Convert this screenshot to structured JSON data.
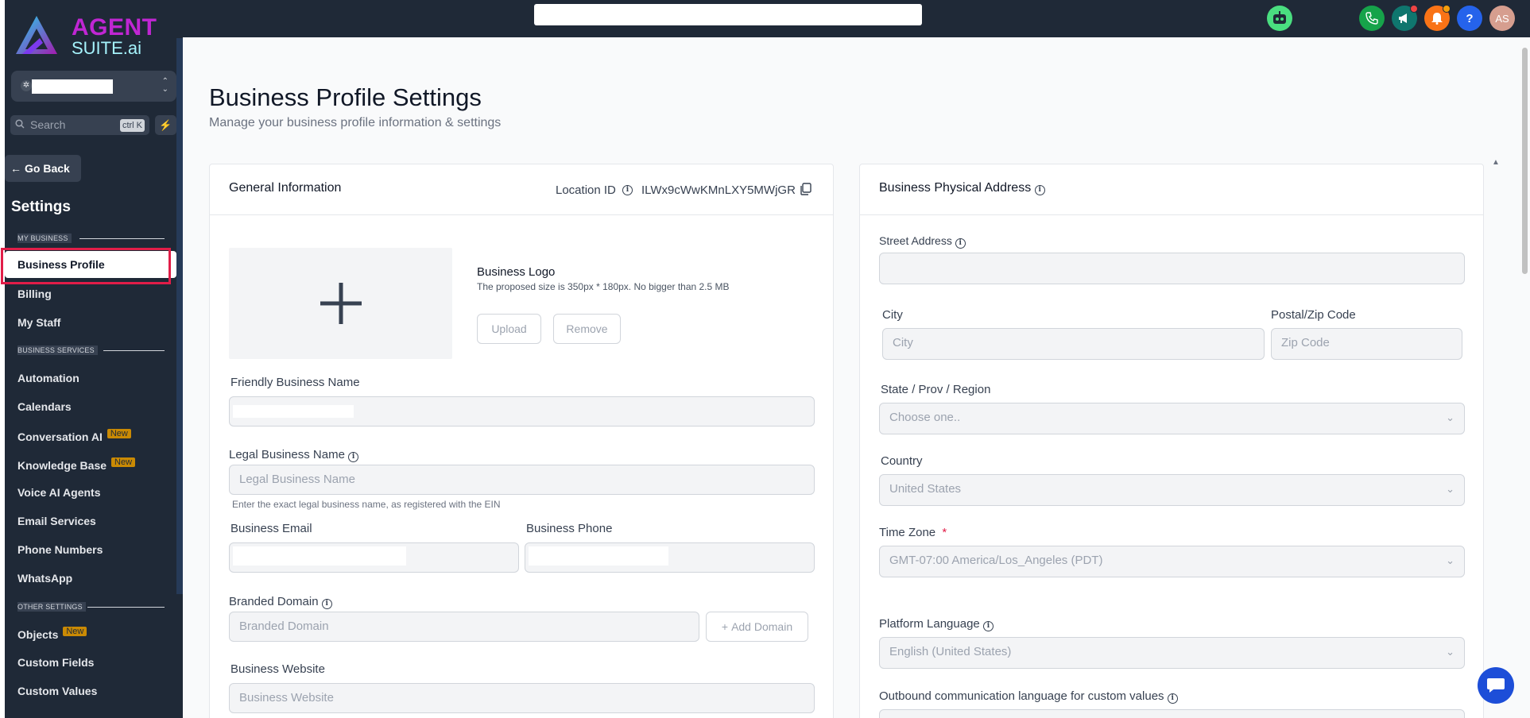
{
  "app": {
    "logo_line1": "AGENT",
    "logo_line2": "SUITE.ai"
  },
  "topbar": {
    "avatar_initials": "AS",
    "help_label": "?",
    "icons": [
      "robot-icon",
      "phone-icon",
      "megaphone-icon",
      "bell-icon",
      "help-icon"
    ],
    "colors": {
      "phone": "#16a34a",
      "megaphone": "#0f766e",
      "bell": "#f97316",
      "help": "#2563eb",
      "avatar": "#d69e8f",
      "robot": "#4ade80"
    }
  },
  "sidebar": {
    "search_placeholder": "Search",
    "search_shortcut": "ctrl K",
    "go_back": "Go Back",
    "title": "Settings",
    "sections": {
      "my_business": "MY BUSINESS",
      "business_services": "BUSINESS SERVICES",
      "other_settings": "OTHER SETTINGS"
    },
    "items": [
      {
        "label": "Business Profile",
        "active": true
      },
      {
        "label": "Billing"
      },
      {
        "label": "My Staff"
      },
      {
        "label": "Automation"
      },
      {
        "label": "Calendars"
      },
      {
        "label": "Conversation AI",
        "badge": "New"
      },
      {
        "label": "Knowledge Base",
        "badge": "New"
      },
      {
        "label": "Voice AI Agents"
      },
      {
        "label": "Email Services"
      },
      {
        "label": "Phone Numbers"
      },
      {
        "label": "WhatsApp"
      },
      {
        "label": "Objects",
        "badge": "New"
      },
      {
        "label": "Custom Fields"
      },
      {
        "label": "Custom Values"
      }
    ]
  },
  "page": {
    "title": "Business Profile Settings",
    "subtitle": "Manage your business profile information & settings"
  },
  "general": {
    "title": "General Information",
    "location_id_label": "Location ID",
    "location_id": "ILWx9cWwKMnLXY5MWjGR",
    "logo_title": "Business Logo",
    "logo_hint": "The proposed size is 350px * 180px. No bigger than 2.5 MB",
    "upload": "Upload",
    "remove": "Remove",
    "friendly_name_label": "Friendly Business Name",
    "legal_name_label": "Legal Business Name",
    "legal_name_placeholder": "Legal Business Name",
    "legal_name_help": "Enter the exact legal business name, as registered with the EIN",
    "email_label": "Business Email",
    "phone_label": "Business Phone",
    "branded_domain_label": "Branded Domain",
    "branded_domain_placeholder": "Branded Domain",
    "add_domain": "Add Domain",
    "website_label": "Business Website",
    "website_placeholder": "Business Website"
  },
  "address": {
    "title": "Business Physical Address",
    "street_label": "Street Address",
    "city_label": "City",
    "city_placeholder": "City",
    "zip_label": "Postal/Zip Code",
    "zip_placeholder": "Zip Code",
    "state_label": "State / Prov / Region",
    "state_placeholder": "Choose one..",
    "country_label": "Country",
    "country_value": "United States",
    "timezone_label": "Time Zone",
    "timezone_required": "*",
    "timezone_value": "GMT-07:00 America/Los_Angeles (PDT)",
    "platform_language_label": "Platform Language",
    "platform_language_value": "English (United States)",
    "outbound_language_label": "Outbound communication language for custom values"
  }
}
